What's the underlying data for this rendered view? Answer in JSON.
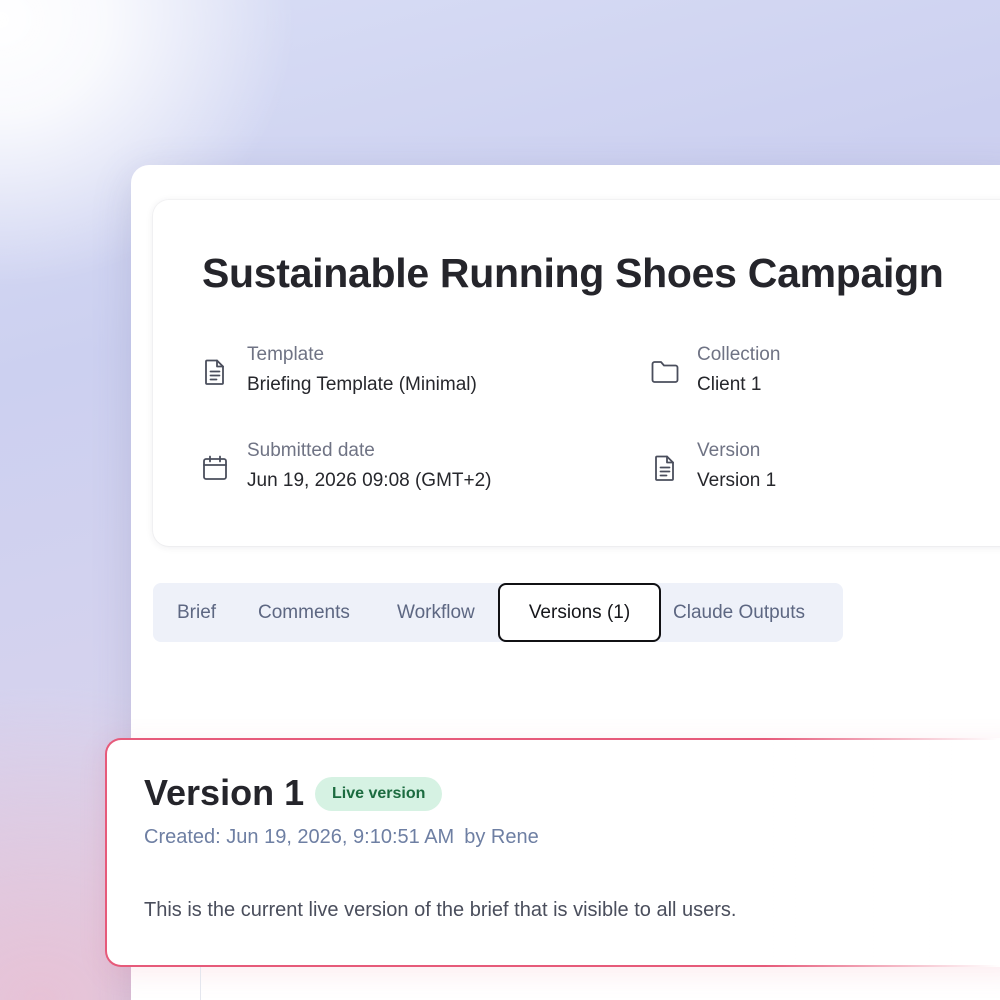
{
  "brief": {
    "title": "Sustainable Running Shoes Campaign"
  },
  "meta": {
    "template": {
      "label": "Template",
      "value": "Briefing Template (Minimal)",
      "icon": "document-icon"
    },
    "collection": {
      "label": "Collection",
      "value": "Client 1",
      "icon": "folder-icon"
    },
    "submitted": {
      "label": "Submitted date",
      "value": "Jun 19, 2026 09:08 (GMT+2)",
      "icon": "calendar-icon"
    },
    "version": {
      "label": "Version",
      "value": "Version 1",
      "icon": "document-icon"
    }
  },
  "tabs": [
    {
      "label": "Brief",
      "active": false
    },
    {
      "label": "Comments",
      "active": false
    },
    {
      "label": "Workflow",
      "active": false
    },
    {
      "label": "Versions (1)",
      "active": true
    },
    {
      "label": "Claude Outputs",
      "active": false
    }
  ],
  "version_card": {
    "title": "Version 1",
    "badge": "Live version",
    "created": "Created: Jun 19, 2026, 9:10:51 AM",
    "author": "by Rene",
    "description": "This is the current live version of the brief that is visible to all users."
  },
  "colors": {
    "accent_border": "#e65a7a",
    "badge_bg": "#d6f2e3",
    "badge_text": "#1b6b3f",
    "tab_bar_bg": "#eef1f9"
  }
}
